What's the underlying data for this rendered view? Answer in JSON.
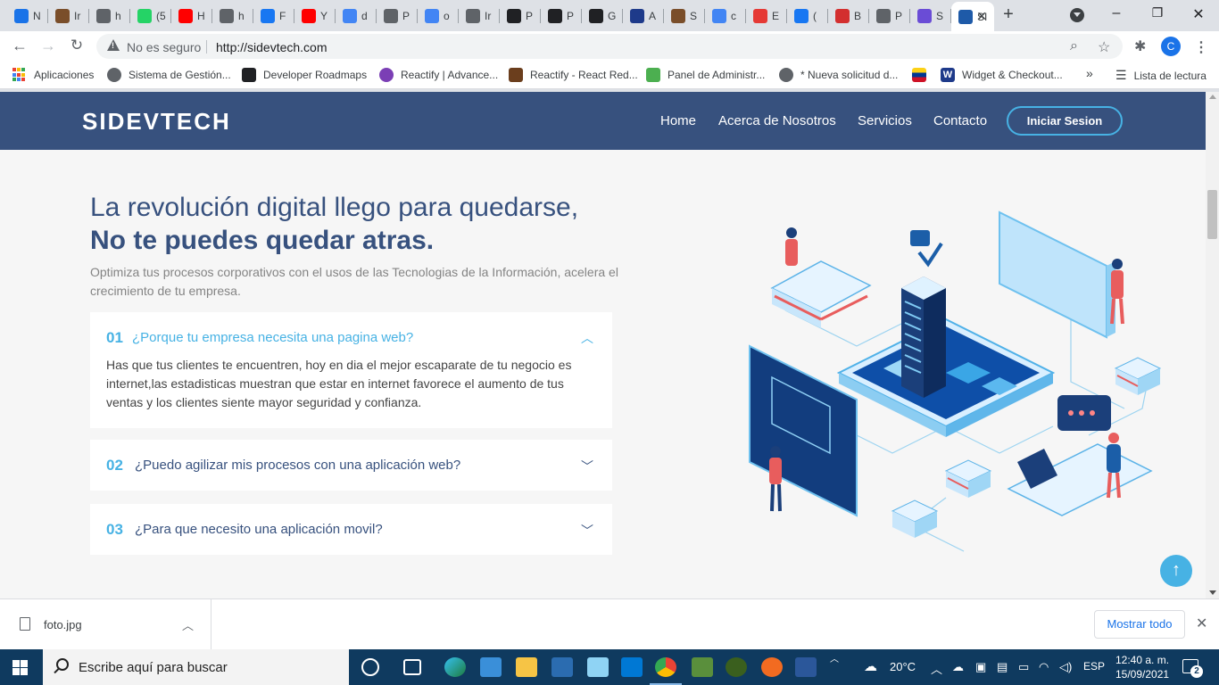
{
  "browser": {
    "tabs": [
      {
        "label": "N",
        "icon": "calendar-icon",
        "color": "#1a73e8"
      },
      {
        "label": "Ir",
        "icon": "crest-icon",
        "color": "#7a4e2a"
      },
      {
        "label": "h",
        "icon": "globe-icon",
        "color": "#5f6368"
      },
      {
        "label": "(5",
        "icon": "whatsapp-icon",
        "color": "#25d366"
      },
      {
        "label": "H",
        "icon": "youtube-icon",
        "color": "#ff0000"
      },
      {
        "label": "h",
        "icon": "globe-icon",
        "color": "#5f6368"
      },
      {
        "label": "F",
        "icon": "facebook-icon",
        "color": "#1877f2"
      },
      {
        "label": "Y",
        "icon": "youtube-icon",
        "color": "#ff0000"
      },
      {
        "label": "d",
        "icon": "google-icon",
        "color": "#4285f4"
      },
      {
        "label": "P",
        "icon": "globe-icon",
        "color": "#5f6368"
      },
      {
        "label": "o",
        "icon": "google-icon",
        "color": "#4285f4"
      },
      {
        "label": "Ir",
        "icon": "globe-icon",
        "color": "#5f6368"
      },
      {
        "label": "P",
        "icon": "bowtie-icon",
        "color": "#202124"
      },
      {
        "label": "P",
        "icon": "bowtie-icon",
        "color": "#202124"
      },
      {
        "label": "G",
        "icon": "github-icon",
        "color": "#202124"
      },
      {
        "label": "A",
        "icon": "circle-icon",
        "color": "#1e3a8a"
      },
      {
        "label": "S",
        "icon": "crest-icon",
        "color": "#7a4e2a"
      },
      {
        "label": "c",
        "icon": "google-icon",
        "color": "#4285f4"
      },
      {
        "label": "E",
        "icon": "paperplane-icon",
        "color": "#e53935"
      },
      {
        "label": "(",
        "icon": "facebook-icon",
        "color": "#1877f2"
      },
      {
        "label": "B",
        "icon": "bank-icon",
        "color": "#d32f2f"
      },
      {
        "label": "P",
        "icon": "globe-icon",
        "color": "#5f6368"
      },
      {
        "label": "S",
        "icon": "hubspot-icon",
        "color": "#6a4cd6"
      }
    ],
    "active_tab": {
      "label": "SI"
    },
    "address": {
      "security": "No es seguro",
      "url": "http://sidevtech.com"
    },
    "profile_initial": "C",
    "bookmarks": [
      {
        "label": "Aplicaciones"
      },
      {
        "label": "Sistema de Gestión..."
      },
      {
        "label": "Developer Roadmaps"
      },
      {
        "label": "Reactify | Advance..."
      },
      {
        "label": "Reactify - React Red..."
      },
      {
        "label": "Panel de Administr..."
      },
      {
        "label": "* Nueva solicitud d..."
      },
      {
        "label": ""
      },
      {
        "label": "Widget & Checkout..."
      }
    ],
    "bookmarks_more": "»",
    "reading_list": "Lista de lectura"
  },
  "site": {
    "logo": "SIDEVTECH",
    "nav": [
      "Home",
      "Acerca de Nosotros",
      "Servicios",
      "Contacto"
    ],
    "login": "Iniciar Sesion",
    "hero": {
      "title": "La revolución digital llego para quedarse,",
      "title_bold": "No te puedes quedar atras.",
      "subtitle": "Optimiza tus procesos corporativos con el usos de las Tecnologias de la Información, acelera el crecimiento de tu empresa."
    },
    "faq": [
      {
        "num": "01",
        "question": "¿Porque tu empresa necesita una pagina web?",
        "expanded": true,
        "answer": "Has que tus clientes te encuentren, hoy en dia el mejor escaparate de tu negocio es internet,las estadisticas muestran que estar en internet favorece el aumento de tus ventas y los clientes siente mayor seguridad y confianza."
      },
      {
        "num": "02",
        "question": "¿Puedo agilizar mis procesos con una aplicación web?",
        "expanded": false
      },
      {
        "num": "03",
        "question": "¿Para que necesito una aplicación movil?",
        "expanded": false
      }
    ],
    "colors": {
      "header": "#37517e",
      "accent": "#47b2e4",
      "bg": "#f6f6f6"
    }
  },
  "download": {
    "file": "foto.jpg",
    "show_all": "Mostrar todo"
  },
  "taskbar": {
    "search_placeholder": "Escribe aquí para buscar",
    "weather": "20°C",
    "lang": "ESP",
    "time": "12:40 a. m.",
    "date": "15/09/2021",
    "notifications": "2"
  }
}
